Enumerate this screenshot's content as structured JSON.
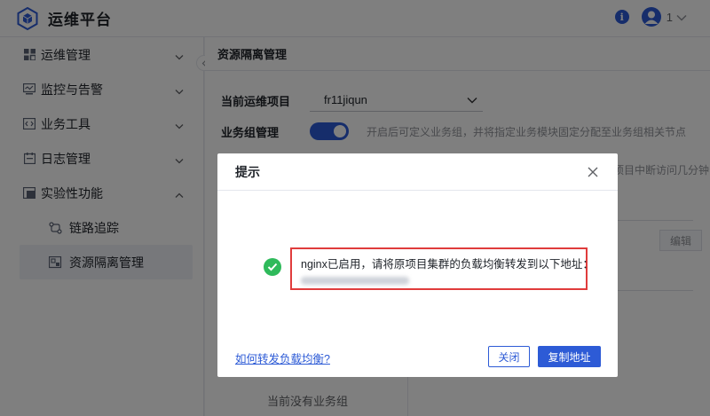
{
  "header": {
    "app_title": "运维平台",
    "user_number": "1",
    "icons": {
      "logo": "hexagon-cube-icon",
      "info": "info-icon",
      "avatar": "user-avatar-icon",
      "chevron": "chevron-down-icon"
    }
  },
  "sidebar": {
    "items": [
      {
        "label": "运维管理",
        "icon": "grid-icon"
      },
      {
        "label": "监控与告警",
        "icon": "monitor-icon"
      },
      {
        "label": "业务工具",
        "icon": "code-icon"
      },
      {
        "label": "日志管理",
        "icon": "calendar-icon"
      },
      {
        "label": "实验性功能",
        "icon": "experiment-icon"
      }
    ],
    "sub_items": [
      {
        "label": "链路追踪",
        "icon": "trace-icon"
      },
      {
        "label": "资源隔离管理",
        "icon": "isolation-icon"
      }
    ]
  },
  "page": {
    "title": "资源隔离管理",
    "project_label": "当前运维项目",
    "project_value": "fr11jiqun",
    "group_label": "业务组管理",
    "group_hint": "开启后可定义业务组，并将指定业务模块固定分配至业务组相关节点",
    "hint2": "项目中断访问几分钟",
    "edit_label": "编辑",
    "empty_text": "当前没有业务组"
  },
  "dialog": {
    "title": "提示",
    "message": "nginx已启用，请将原项目集群的负载均衡转发到以下地址：",
    "help_link": "如何转发负载均衡?",
    "close_label": "关闭",
    "copy_label": "复制地址"
  },
  "colors": {
    "primary": "#2d5bd6",
    "success": "#2fba5b",
    "highlight": "#e03c3c"
  }
}
